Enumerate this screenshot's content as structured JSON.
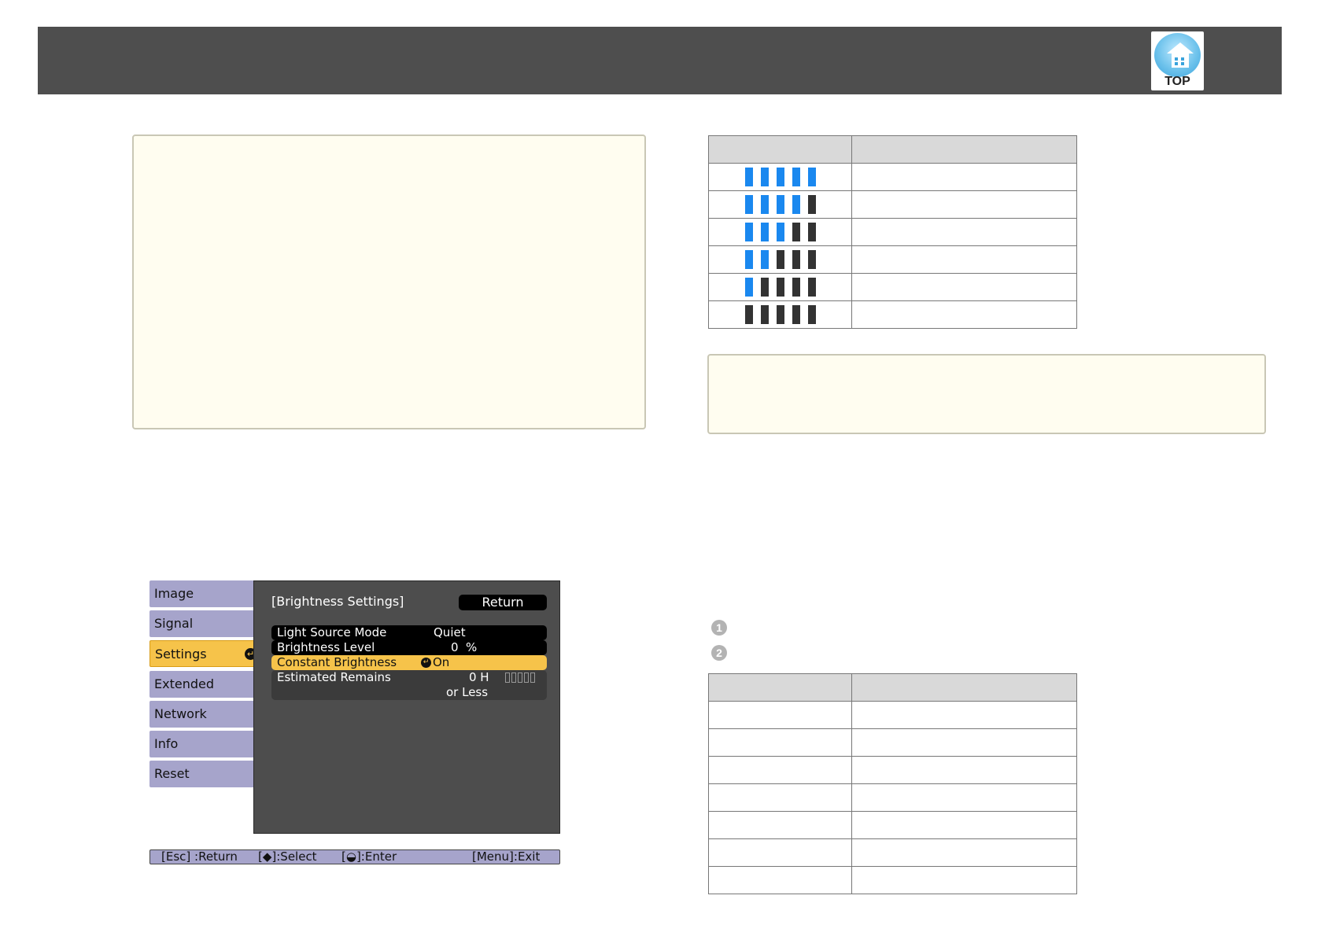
{
  "header": {
    "top_button_label": "TOP",
    "top_button_icon": "home-icon"
  },
  "gauge_table": {
    "rows": [
      {
        "filled": 5,
        "total": 5
      },
      {
        "filled": 4,
        "total": 5
      },
      {
        "filled": 3,
        "total": 5
      },
      {
        "filled": 2,
        "total": 5
      },
      {
        "filled": 1,
        "total": 5
      },
      {
        "filled": 0,
        "total": 5
      }
    ],
    "colors": {
      "filled": "#1a88ef",
      "empty": "#333333"
    }
  },
  "menu": {
    "tabs": [
      {
        "label": "Image"
      },
      {
        "label": "Signal"
      },
      {
        "label": "Settings",
        "active": true
      },
      {
        "label": "Extended"
      },
      {
        "label": "Network"
      },
      {
        "label": "Info"
      },
      {
        "label": "Reset"
      }
    ],
    "panel_title": "[Brightness Settings]",
    "return_label": "Return",
    "rows": {
      "light_source_mode": {
        "label": "Light Source Mode",
        "value": "Quiet"
      },
      "brightness_level": {
        "label": "Brightness Level",
        "value": "0",
        "unit": "%"
      },
      "constant_brightness": {
        "label": "Constant Brightness",
        "value": "On"
      },
      "estimated_remains": {
        "label": "Estimated Remains",
        "value": "0 H",
        "sub": "or Less"
      }
    },
    "help": {
      "esc": "[Esc] :Return",
      "select": "[◆]:Select",
      "enter": "[◒]:Enter",
      "menu": "[Menu]:Exit"
    },
    "accent_color": "#f6c34a",
    "tab_color": "#a6a4cb"
  },
  "callouts": [
    "1",
    "2"
  ],
  "bottom_table": {
    "row_count": 7
  }
}
